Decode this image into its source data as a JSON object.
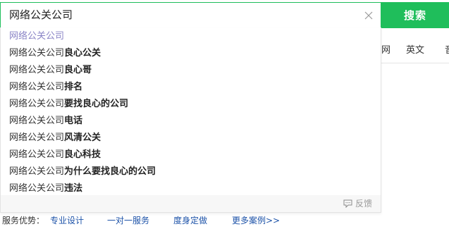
{
  "search": {
    "value": "网络公关公司",
    "button_label": "搜索"
  },
  "tabs": [
    {
      "label": "网"
    },
    {
      "label": "英文"
    },
    {
      "label": "音"
    }
  ],
  "suggestions": [
    {
      "prefix": "网络公关公司",
      "bold": ""
    },
    {
      "prefix": "网络公关公司",
      "bold": "良心公关"
    },
    {
      "prefix": "网络公关公司",
      "bold": "良心哥"
    },
    {
      "prefix": "网络公关公司",
      "bold": "排名"
    },
    {
      "prefix": "网络公关公司",
      "bold": "要找良心的公司"
    },
    {
      "prefix": "网络公关公司",
      "bold": "电话"
    },
    {
      "prefix": "网络公关公司",
      "bold": "风清公关"
    },
    {
      "prefix": "网络公关公司",
      "bold": "良心科技"
    },
    {
      "prefix": "网络公关公司",
      "bold": "为什么要找良心的公司"
    },
    {
      "prefix": "网络公关公司",
      "bold": "违法"
    }
  ],
  "feedback_label": "反馈",
  "bottom": {
    "label": "服务优势：",
    "links": [
      "专业设计",
      "一对一服务",
      "度身定做",
      "更多案例>>"
    ]
  },
  "colors": {
    "accent": "#1fbe5b",
    "link": "#1c52a8",
    "first_suggestion": "#8a84c6"
  }
}
